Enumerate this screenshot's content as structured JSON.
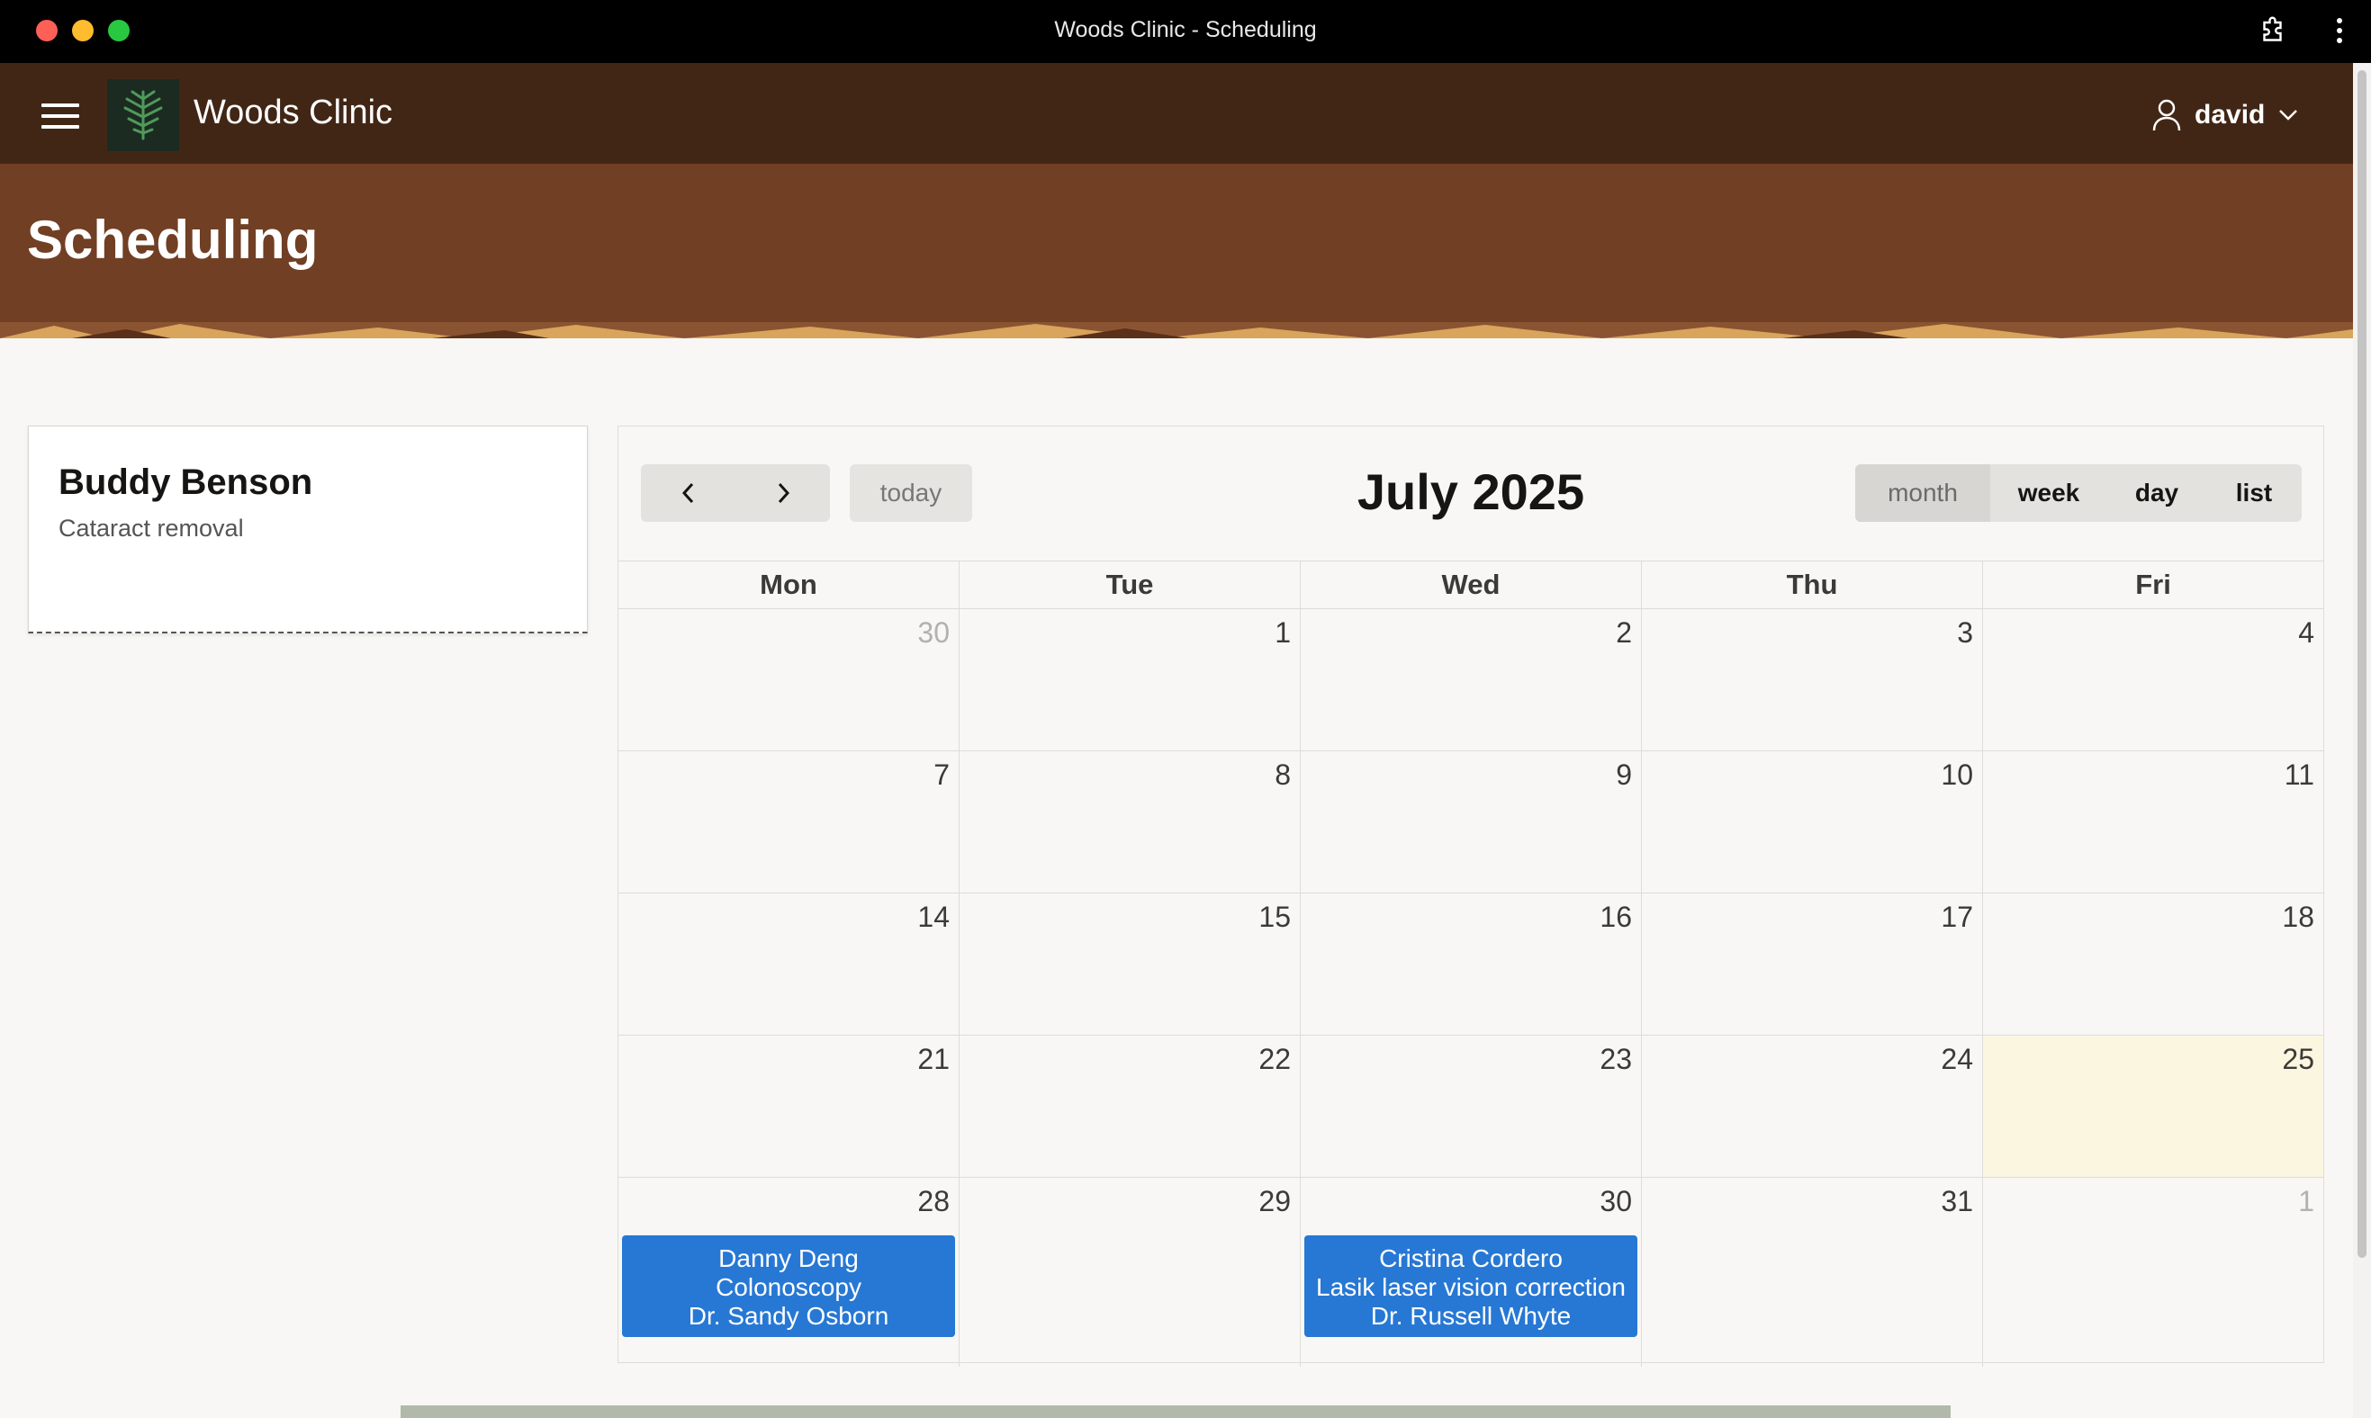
{
  "window": {
    "title": "Woods Clinic - Scheduling"
  },
  "navbar": {
    "app_name": "Woods Clinic",
    "user": "david"
  },
  "hero": {
    "title": "Scheduling"
  },
  "patient_card": {
    "name": "Buddy Benson",
    "procedure": "Cataract removal"
  },
  "calendar": {
    "title": "July 2025",
    "today_label": "today",
    "views": [
      "month",
      "week",
      "day",
      "list"
    ],
    "active_view": "month",
    "weekdays": [
      "Mon",
      "Tue",
      "Wed",
      "Thu",
      "Fri"
    ],
    "weeks": [
      [
        {
          "num": "30",
          "other": true
        },
        {
          "num": "1"
        },
        {
          "num": "2"
        },
        {
          "num": "3"
        },
        {
          "num": "4"
        }
      ],
      [
        {
          "num": "7"
        },
        {
          "num": "8"
        },
        {
          "num": "9"
        },
        {
          "num": "10"
        },
        {
          "num": "11"
        }
      ],
      [
        {
          "num": "14"
        },
        {
          "num": "15"
        },
        {
          "num": "16"
        },
        {
          "num": "17"
        },
        {
          "num": "18"
        }
      ],
      [
        {
          "num": "21"
        },
        {
          "num": "22"
        },
        {
          "num": "23"
        },
        {
          "num": "24"
        },
        {
          "num": "25",
          "today": true
        }
      ],
      [
        {
          "num": "28",
          "event": {
            "patient": "Danny Deng",
            "procedure": "Colonoscopy",
            "doctor": "Dr. Sandy Osborn"
          }
        },
        {
          "num": "29"
        },
        {
          "num": "30",
          "event": {
            "patient": "Cristina Cordero",
            "procedure": "Lasik laser vision correction",
            "doctor": "Dr. Russell Whyte"
          }
        },
        {
          "num": "31"
        },
        {
          "num": "1",
          "other": true
        }
      ]
    ]
  },
  "colors": {
    "navbar": "#412616",
    "hero": "#713f24",
    "event": "#2778d4",
    "today_cell": "#fbf6e0"
  }
}
